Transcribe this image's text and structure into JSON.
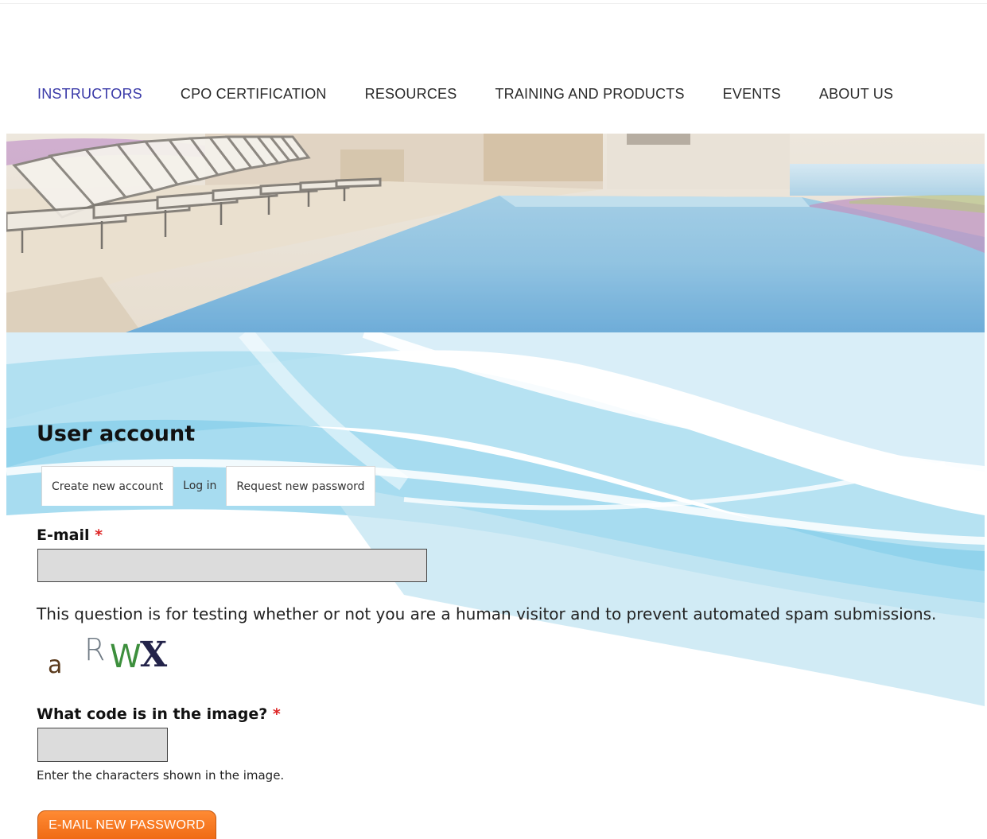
{
  "nav": {
    "items": [
      {
        "label": "INSTRUCTORS",
        "active": true
      },
      {
        "label": "CPO CERTIFICATION",
        "active": false
      },
      {
        "label": "RESOURCES",
        "active": false
      },
      {
        "label": "TRAINING AND PRODUCTS",
        "active": false
      },
      {
        "label": "EVENTS",
        "active": false
      },
      {
        "label": "ABOUT US",
        "active": false
      }
    ]
  },
  "page": {
    "title": "User account"
  },
  "tabs": [
    {
      "label": "Create new account"
    },
    {
      "label": "Log in"
    },
    {
      "label": "Request new password"
    }
  ],
  "form": {
    "email_label": "E-mail",
    "required_marker": "*",
    "email_value": "",
    "captcha_notice": "This question is for testing whether or not you are a human visitor and to prevent automated spam submissions.",
    "captcha_chars": [
      "a",
      "R",
      "W",
      "X"
    ],
    "code_label": "What code is in the image?",
    "code_value": "",
    "code_help": "Enter the characters shown in the image.",
    "submit_label": "E-MAIL NEW PASSWORD"
  },
  "colors": {
    "nav_active": "#3a3aa8",
    "required": "#dd2222",
    "button": "#ef6a14"
  }
}
